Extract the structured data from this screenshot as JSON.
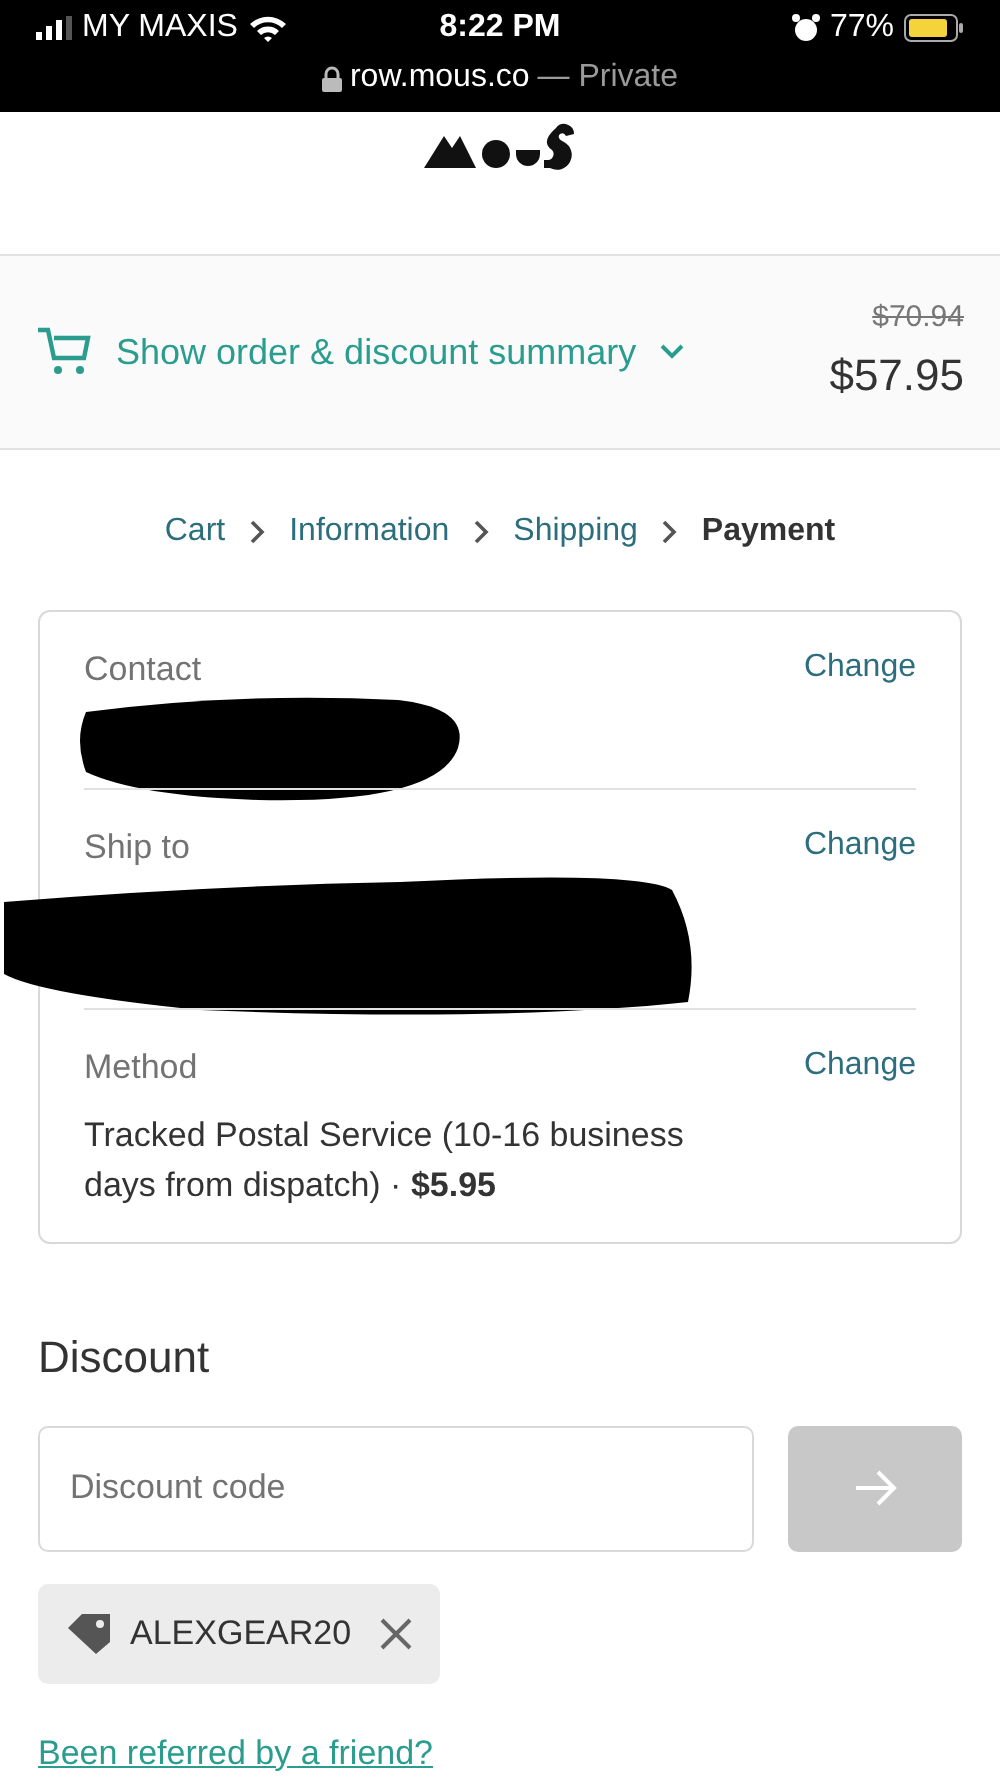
{
  "status_bar": {
    "carrier": "MY MAXIS",
    "time": "8:22 PM",
    "battery": "77%",
    "url": "row.mous.co",
    "mode": "— Private"
  },
  "summary": {
    "label": "Show order & discount summary",
    "original_price": "$70.94",
    "price": "$57.95"
  },
  "breadcrumbs": [
    {
      "label": "Cart",
      "selected": false
    },
    {
      "label": "Information",
      "selected": false
    },
    {
      "label": "Shipping",
      "selected": false
    },
    {
      "label": "Payment",
      "selected": true
    }
  ],
  "review": [
    {
      "label": "Contact",
      "action": "Change",
      "redacted": true
    },
    {
      "label": "Ship to",
      "action": "Change",
      "redacted": true
    },
    {
      "label": "Method",
      "action": "Change",
      "redacted": false,
      "value": "Tracked Postal Service (10-16 business days from dispatch) · **$5.95**"
    }
  ],
  "discount": {
    "heading": "Discount",
    "placeholder": "Discount code",
    "tag": "ALEXGEAR20",
    "link": "Been referred by a friend?"
  }
}
